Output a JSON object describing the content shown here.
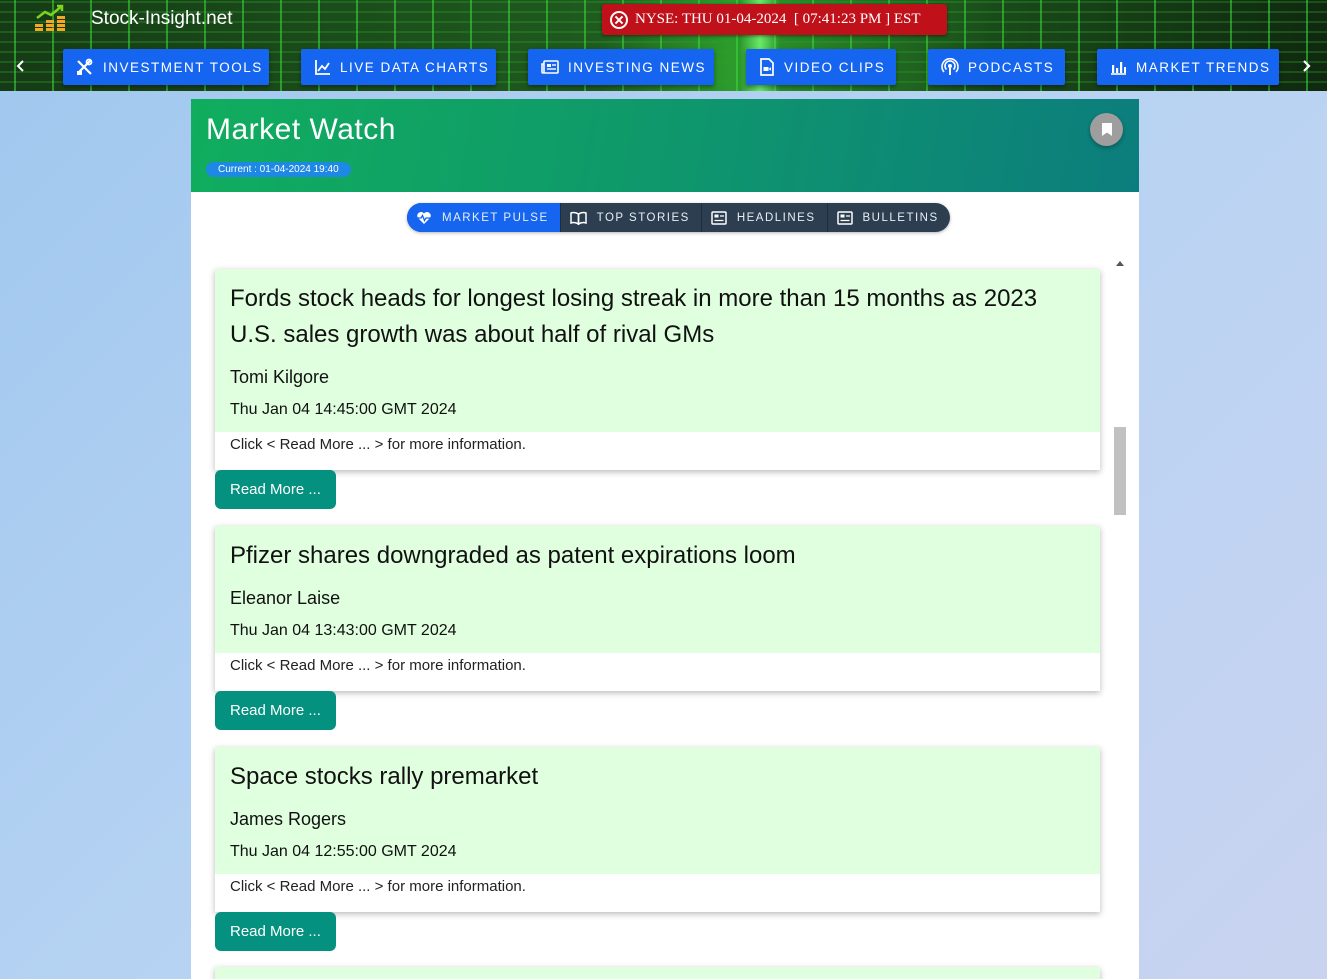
{
  "brand": {
    "name": "Stock-Insight.net"
  },
  "clock": {
    "text": "NYSE: THU 01-04-2024  [ 07:41:23 PM ] EST",
    "color": "#c0111a"
  },
  "nav": {
    "items": [
      {
        "label": "INVESTMENT TOOLS",
        "icon": "tools-icon"
      },
      {
        "label": "LIVE DATA CHARTS",
        "icon": "line-chart-icon"
      },
      {
        "label": "INVESTING NEWS",
        "icon": "newspaper-icon"
      },
      {
        "label": "VIDEO CLIPS",
        "icon": "video-file-icon"
      },
      {
        "label": "PODCASTS",
        "icon": "podcast-icon"
      },
      {
        "label": "MARKET TRENDS",
        "icon": "bar-chart-icon"
      }
    ],
    "accent": "#1565f0"
  },
  "card": {
    "title": "Market Watch",
    "current": "Current : 01-04-2024 19:40"
  },
  "tabs": [
    {
      "label": "MARKET PULSE",
      "icon": "heart-pulse-icon",
      "active": true
    },
    {
      "label": "TOP STORIES",
      "icon": "book-open-icon",
      "active": false
    },
    {
      "label": "HEADLINES",
      "icon": "article-icon",
      "active": false
    },
    {
      "label": "BULLETINS",
      "icon": "article-icon",
      "active": false
    }
  ],
  "news": [
    {
      "title": "Fords stock heads for longest losing streak in more than 15 months as 2023 U.S. sales growth was about half of rival GMs",
      "author": "Tomi Kilgore",
      "date": "Thu Jan 04 14:45:00 GMT 2024",
      "note": "Click < Read More ... > for more information.",
      "button": "Read More ..."
    },
    {
      "title": "Pfizer shares downgraded as patent expirations loom",
      "author": "Eleanor Laise",
      "date": "Thu Jan 04 13:43:00 GMT 2024",
      "note": "Click < Read More ... > for more information.",
      "button": "Read More ..."
    },
    {
      "title": "Space stocks rally premarket",
      "author": "James Rogers",
      "date": "Thu Jan 04 12:55:00 GMT 2024",
      "note": "Click < Read More ... > for more information.",
      "button": "Read More ..."
    }
  ]
}
